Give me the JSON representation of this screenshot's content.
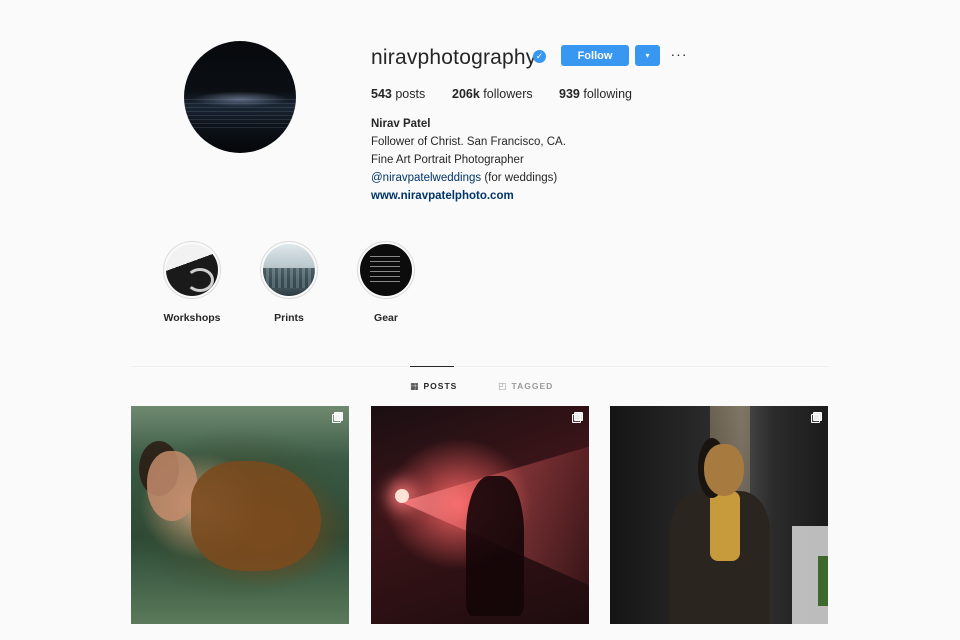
{
  "profile": {
    "username": "niravphotography",
    "verified": true,
    "follow_label": "Follow",
    "dropdown_glyph": "▾",
    "more_glyph": "···",
    "stats": [
      {
        "count": "543",
        "label": "posts"
      },
      {
        "count": "206k",
        "label": "followers"
      },
      {
        "count": "939",
        "label": "following"
      }
    ],
    "bio": {
      "name": "Nirav Patel",
      "line1": "Follower of Christ. San Francisco, CA.",
      "line2": "Fine Art Portrait Photographer",
      "mention": "@niravpatelweddings",
      "mention_suffix": " (for weddings)",
      "website": "www.niravpatelphoto.com"
    }
  },
  "highlights": [
    {
      "label": "Workshops"
    },
    {
      "label": "Prints"
    },
    {
      "label": "Gear"
    }
  ],
  "tabs": [
    {
      "label": "POSTS",
      "icon": "grid-icon",
      "active": true
    },
    {
      "label": "TAGGED",
      "icon": "tag-icon",
      "active": false
    }
  ],
  "posts": [
    {
      "description": "woman-in-bathtub",
      "multiple": true
    },
    {
      "description": "red-light-beam-silhouette",
      "multiple": true
    },
    {
      "description": "portrait-light-stripe",
      "multiple": true
    }
  ],
  "colors": {
    "accent": "#3897f0",
    "link": "#003569",
    "background": "#fafafa"
  }
}
